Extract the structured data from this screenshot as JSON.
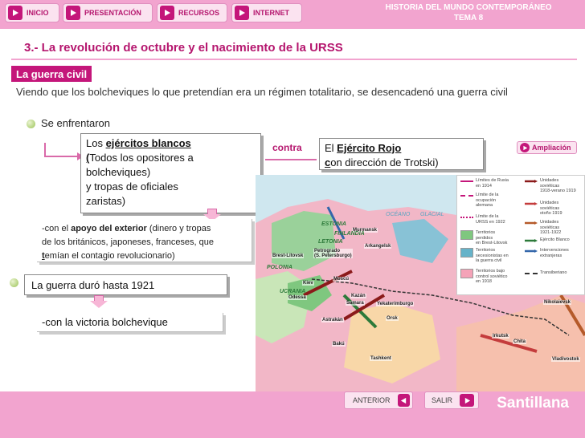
{
  "nav": {
    "inicio": "INICIO",
    "presentacion": "PRESENTACIÓN",
    "recursos": "RECURSOS",
    "internet": "INTERNET"
  },
  "app": {
    "title_line1": "HISTORIA DEL MUNDO CONTEMPORÁNEO",
    "title_line2": "TEMA 8"
  },
  "slide": {
    "title": "3.- La revolución de octubre y el nacimiento de la URSS",
    "section": "La guerra civil",
    "intro": "Viendo que los bolcheviques lo que pretendían era un régimen totalitario, se desencadenó una guerra civil",
    "se_enfrentaron": "Se enfrentaron",
    "blancos": {
      "pre": "Los ",
      "strong": "ejércitos blancos",
      "l2_first": "(",
      "l2_rest": "Todos los opositores a",
      "l3": "bolcheviques)",
      "l4": "y tropas de oficiales",
      "l5": "zaristas)"
    },
    "contra": "contra",
    "rojo": {
      "pre": "El ",
      "strong": "Ejército Rojo",
      "l2_first": "c",
      "l2_rest": "on dirección de Trotski)"
    },
    "apoyo": {
      "pre": "-con el ",
      "strong": "apoyo del exterior",
      "post": " (dinero y tropas",
      "l2": "de los británicos, japoneses, franceses, que",
      "l3_first": "t",
      "l3_rest": "emían el contagio revolucionario)"
    },
    "duro": "La guerra duró hasta 1921",
    "victoria": "-con la victoria bolchevique",
    "ampliacion": "Ampliación"
  },
  "map": {
    "legend": [
      {
        "label": "Límites de Rusia\nen 1914",
        "color": "#c4167a",
        "kind": "line"
      },
      {
        "label": "Límite de la\nocupación\nalemana",
        "color": "#c4167a",
        "kind": "dash"
      },
      {
        "label": "Límite de la\nURSS en 1922",
        "color": "#c4167a",
        "kind": "dot"
      },
      {
        "label": "Territorios\nperdidos\nen Brest-Litovsk",
        "color": "#7fc77f",
        "kind": "fill"
      },
      {
        "label": "Territorios\nsecesionistas en\nla guerra civil",
        "color": "#66b3c9",
        "kind": "fill"
      },
      {
        "label": "Territorios bajo\ncontrol soviético\nen 1918",
        "color": "#f4a3b8",
        "kind": "fill"
      },
      {
        "label": "Unidades\nsoviéticas\n1918-verano 1919",
        "color": "#8b1a1a",
        "kind": "arrow"
      },
      {
        "label": "Unidades\nsoviéticas\notoño 1919",
        "color": "#c43c3c",
        "kind": "arrow"
      },
      {
        "label": "Unidades\nsoviéticas\n1921-1922",
        "color": "#b55a2a",
        "kind": "arrow"
      },
      {
        "label": "Ejército Blanco",
        "color": "#2d7a3a",
        "kind": "arrow"
      },
      {
        "label": "Intervenciones\nextranjeras",
        "color": "#3366aa",
        "kind": "arrow"
      },
      {
        "label": "Transiberiano",
        "color": "#333333",
        "kind": "rail"
      }
    ],
    "seas": [
      "OCÉANO",
      "GLACIAL"
    ],
    "cities": [
      "Murmansk",
      "Arkangelsk",
      "Petrogrado\n(S. Petersburgo)",
      "Brest-Litovsk",
      "Moscú",
      "Kiev",
      "Odessa",
      "Kazán",
      "Samara",
      "Yekaterimburgo",
      "Astrakán",
      "Orsk",
      "Bakú",
      "Tashkent",
      "Irkutsk",
      "Chita",
      "Nikolaievsk",
      "Vladivostok"
    ],
    "regions": [
      "FINLANDIA",
      "LETONIA",
      "ESTONIA",
      "POLONIA",
      "UCRANIA"
    ]
  },
  "footer": {
    "anterior": "ANTERIOR",
    "salir": "SALIR",
    "brand": "Santillana"
  },
  "colors": {
    "brand_magenta": "#c4167a",
    "bar_pink": "#f2a4cf",
    "bullet_green": "#9ac254"
  }
}
